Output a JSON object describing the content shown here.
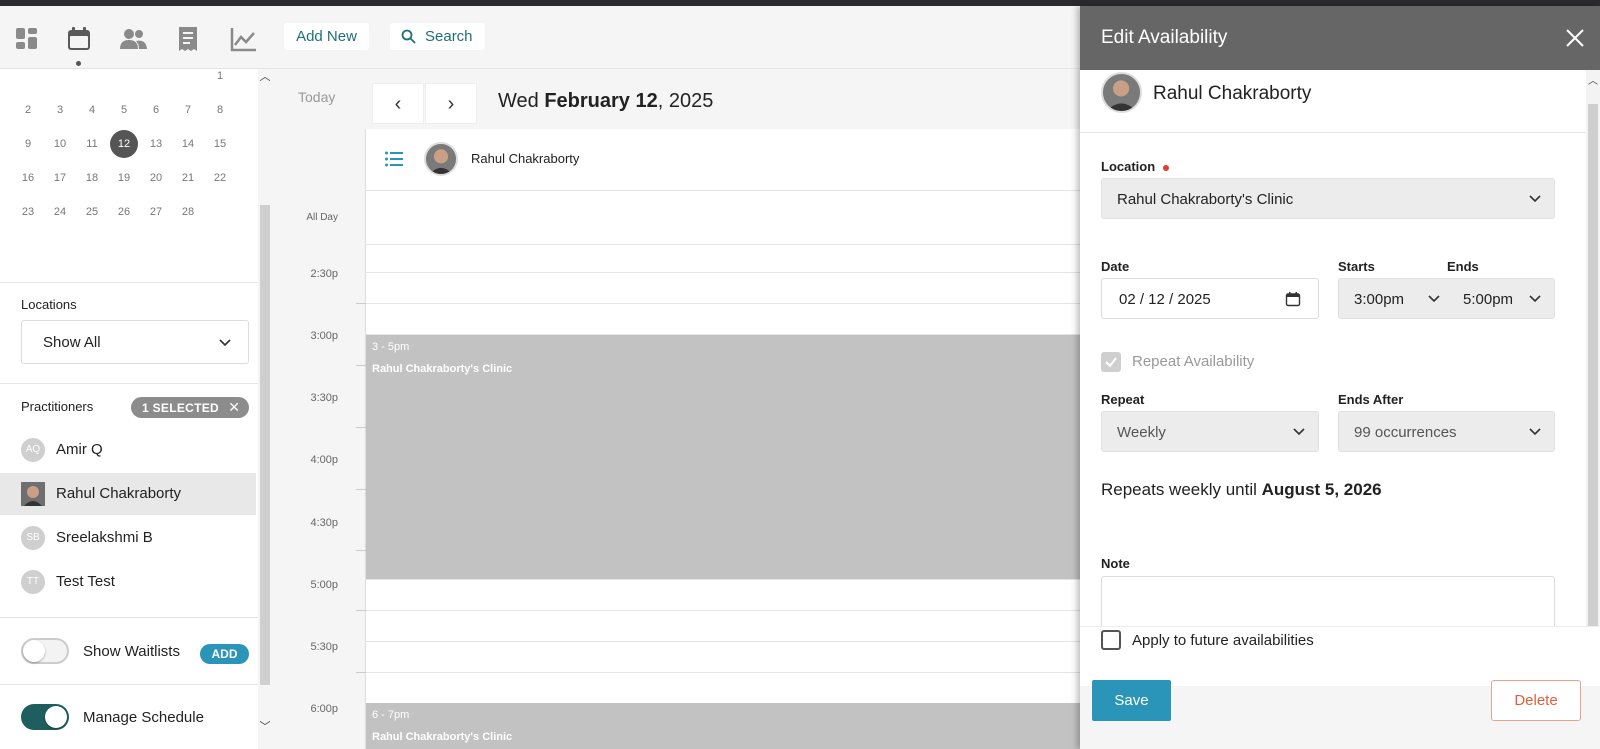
{
  "left_nav": {
    "icons": [
      "dashboard-icon",
      "calendar-icon",
      "people-icon",
      "receipt-icon",
      "chart-icon"
    ],
    "mini_calendar": {
      "days": [
        [
          "",
          "",
          "",
          "",
          "",
          "",
          "1"
        ],
        [
          "2",
          "3",
          "4",
          "5",
          "6",
          "7",
          "8"
        ],
        [
          "9",
          "10",
          "11",
          "12",
          "13",
          "14",
          "15"
        ],
        [
          "16",
          "17",
          "18",
          "19",
          "20",
          "21",
          "22"
        ],
        [
          "23",
          "24",
          "25",
          "26",
          "27",
          "28",
          ""
        ]
      ],
      "selected_day": "12"
    },
    "locations": {
      "label": "Locations",
      "selected": "Show All"
    },
    "practitioners": {
      "label": "Practitioners",
      "selected_badge": "1 SELECTED",
      "items": [
        {
          "initials": "AQ",
          "name": "Amir Q"
        },
        {
          "initials": "",
          "name": "Rahul Chakraborty"
        },
        {
          "initials": "SB",
          "name": "Sreelakshmi B"
        },
        {
          "initials": "TT",
          "name": "Test Test"
        }
      ]
    },
    "show_waitlists": {
      "label": "Show Waitlists",
      "add": "ADD"
    },
    "manage_schedule": {
      "label": "Manage Schedule"
    }
  },
  "toolbar": {
    "add_new": "Add New",
    "search": "Search"
  },
  "date_nav": {
    "today": "Today",
    "weekday": "Wed",
    "date_bold": "February 12",
    "year": ", 2025"
  },
  "calendar": {
    "column_name": "Rahul Chakraborty",
    "all_day": "All Day",
    "times": [
      "2:30p",
      "3:00p",
      "3:30p",
      "4:00p",
      "4:30p",
      "5:00p",
      "5:30p",
      "6:00p"
    ],
    "events": [
      {
        "time": "3 - 5pm",
        "location": "Rahul Chakraborty's Clinic"
      },
      {
        "time": "6 - 7pm",
        "location": "Rahul Chakraborty's Clinic"
      }
    ]
  },
  "edit_panel": {
    "title": "Edit Availability",
    "practitioner": "Rahul Chakraborty",
    "location_label": "Location",
    "location_value": "Rahul Chakraborty's Clinic",
    "date_label": "Date",
    "date_value": "02 / 12 / 2025",
    "starts_label": "Starts",
    "starts_value": "3:00pm",
    "ends_label": "Ends",
    "ends_value": "5:00pm",
    "repeat_availability": "Repeat Availability",
    "repeat_label": "Repeat",
    "repeat_value": "Weekly",
    "ends_after_label": "Ends After",
    "ends_after_value": "99 occurrences",
    "summary_prefix": "Repeats weekly until ",
    "summary_date": "August 5, 2026",
    "note_label": "Note",
    "note_value": "",
    "apply_future": "Apply to future availabilities",
    "save": "Save",
    "delete": "Delete"
  }
}
